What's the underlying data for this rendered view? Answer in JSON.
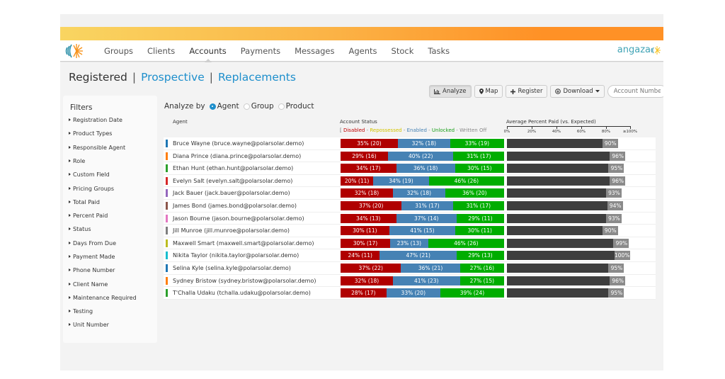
{
  "nav": {
    "items": [
      "Groups",
      "Clients",
      "Accounts",
      "Payments",
      "Messages",
      "Agents",
      "Stock",
      "Tasks"
    ],
    "active": "Accounts",
    "brand": "angaza"
  },
  "subnav": {
    "current": "Registered",
    "links": [
      "Prospective",
      "Replacements"
    ],
    "separator": "|"
  },
  "toolbar": {
    "analyze_label": "Analyze",
    "map_label": "Map",
    "register_label": "Register",
    "download_label": "Download",
    "account_placeholder": "Account Number"
  },
  "filters": {
    "title": "Filters",
    "items": [
      "Registration Date",
      "Product Types",
      "Responsible Agent",
      "Role",
      "Custom Field",
      "Pricing Groups",
      "Total Paid",
      "Percent Paid",
      "Status",
      "Days From Due",
      "Payment Made",
      "Phone Number",
      "Client Name",
      "Maintenance Required",
      "Testing",
      "Unit Number"
    ]
  },
  "analyze": {
    "label": "Analyze by",
    "options": [
      "Agent",
      "Group",
      "Product"
    ],
    "selected": "Agent"
  },
  "table": {
    "agent_header": "Agent",
    "status_header": "Account Status",
    "legend": {
      "open": "[",
      "disabled": "Disabled",
      "repossessed": "Repossessed",
      "enabled": "Enabled",
      "unlocked": "Unlocked",
      "written_off": "Written Off",
      "sep": " - "
    },
    "paid_header": "Average Percent Paid (vs. Expected)",
    "paid_ticks": [
      "0%",
      "20%",
      "40%",
      "60%",
      "80%",
      "≥100%"
    ],
    "colors": {
      "disabled": "#b00000",
      "repossessed": "#d4c400",
      "enabled": "#4682b4",
      "unlocked": "#00ad00",
      "written_off": "#888888"
    },
    "rows": [
      {
        "agent": "Bruce Wayne (bruce.wayne@polarsolar.demo)",
        "color": "#1f77b4",
        "disabled": {
          "pct": 35,
          "n": 20,
          "label": "35% (20)"
        },
        "enabled": {
          "pct": 32,
          "n": 18,
          "label": "32% (18)"
        },
        "unlocked": {
          "pct": 33,
          "n": 19,
          "label": "33% (19)"
        },
        "paid": 90,
        "paid_label": "90%"
      },
      {
        "agent": "Diana Prince (diana.prince@polarsolar.demo)",
        "color": "#ff7f0e",
        "disabled": {
          "pct": 29,
          "n": 16,
          "label": "29% (16)"
        },
        "enabled": {
          "pct": 40,
          "n": 22,
          "label": "40% (22)"
        },
        "unlocked": {
          "pct": 31,
          "n": 17,
          "label": "31% (17)"
        },
        "paid": 96,
        "paid_label": "96%"
      },
      {
        "agent": "Ethan Hunt (ethan.hunt@polarsolar.demo)",
        "color": "#2ca02c",
        "disabled": {
          "pct": 34,
          "n": 17,
          "label": "34% (17)"
        },
        "enabled": {
          "pct": 36,
          "n": 18,
          "label": "36% (18)"
        },
        "unlocked": {
          "pct": 30,
          "n": 15,
          "label": "30% (15)"
        },
        "paid": 95,
        "paid_label": "95%"
      },
      {
        "agent": "Evelyn Salt (evelyn.salt@polarsolar.demo)",
        "color": "#d62728",
        "disabled": {
          "pct": 20,
          "n": 11,
          "label": "20% (11)"
        },
        "enabled": {
          "pct": 34,
          "n": 19,
          "label": "34% (19)"
        },
        "unlocked": {
          "pct": 46,
          "n": 26,
          "label": "46% (26)"
        },
        "paid": 96,
        "paid_label": "96%"
      },
      {
        "agent": "Jack Bauer (jack.bauer@polarsolar.demo)",
        "color": "#9467bd",
        "disabled": {
          "pct": 32,
          "n": 18,
          "label": "32% (18)"
        },
        "enabled": {
          "pct": 32,
          "n": 18,
          "label": "32% (18)"
        },
        "unlocked": {
          "pct": 36,
          "n": 20,
          "label": "36% (20)"
        },
        "paid": 93,
        "paid_label": "93%"
      },
      {
        "agent": "James Bond (james.bond@polarsolar.demo)",
        "color": "#8c564b",
        "disabled": {
          "pct": 37,
          "n": 20,
          "label": "37% (20)"
        },
        "enabled": {
          "pct": 31,
          "n": 17,
          "label": "31% (17)"
        },
        "unlocked": {
          "pct": 31,
          "n": 17,
          "label": "31% (17)"
        },
        "paid": 94,
        "paid_label": "94%"
      },
      {
        "agent": "Jason Bourne (jason.bourne@polarsolar.demo)",
        "color": "#e377c2",
        "disabled": {
          "pct": 34,
          "n": 13,
          "label": "34% (13)"
        },
        "enabled": {
          "pct": 37,
          "n": 14,
          "label": "37% (14)"
        },
        "unlocked": {
          "pct": 29,
          "n": 11,
          "label": "29% (11)"
        },
        "paid": 93,
        "paid_label": "93%"
      },
      {
        "agent": "Jill Munroe (jill.munroe@polarsolar.demo)",
        "color": "#7f7f7f",
        "disabled": {
          "pct": 30,
          "n": 11,
          "label": "30% (11)"
        },
        "enabled": {
          "pct": 41,
          "n": 15,
          "label": "41% (15)"
        },
        "unlocked": {
          "pct": 30,
          "n": 11,
          "label": "30% (11)"
        },
        "paid": 90,
        "paid_label": "90%"
      },
      {
        "agent": "Maxwell Smart (maxwell.smart@polarsolar.demo)",
        "color": "#bcbd22",
        "disabled": {
          "pct": 30,
          "n": 17,
          "label": "30% (17)"
        },
        "enabled": {
          "pct": 23,
          "n": 13,
          "label": "23% (13)"
        },
        "unlocked": {
          "pct": 46,
          "n": 26,
          "label": "46% (26)"
        },
        "paid": 99,
        "paid_label": "99%"
      },
      {
        "agent": "Nikita Taylor (nikita.taylor@polarsolar.demo)",
        "color": "#17becf",
        "disabled": {
          "pct": 24,
          "n": 11,
          "label": "24% (11)"
        },
        "enabled": {
          "pct": 47,
          "n": 21,
          "label": "47% (21)"
        },
        "unlocked": {
          "pct": 29,
          "n": 13,
          "label": "29% (13)"
        },
        "paid": 100,
        "paid_label": "100%"
      },
      {
        "agent": "Selina Kyle (selina.kyle@polarsolar.demo)",
        "color": "#1f77b4",
        "disabled": {
          "pct": 37,
          "n": 22,
          "label": "37% (22)"
        },
        "enabled": {
          "pct": 36,
          "n": 21,
          "label": "36% (21)"
        },
        "unlocked": {
          "pct": 27,
          "n": 16,
          "label": "27% (16)"
        },
        "paid": 95,
        "paid_label": "95%"
      },
      {
        "agent": "Sydney Bristow (sydney.bristow@polarsolar.demo)",
        "color": "#ff7f0e",
        "disabled": {
          "pct": 32,
          "n": 18,
          "label": "32% (18)"
        },
        "enabled": {
          "pct": 41,
          "n": 23,
          "label": "41% (23)"
        },
        "unlocked": {
          "pct": 27,
          "n": 15,
          "label": "27% (15)"
        },
        "paid": 96,
        "paid_label": "96%"
      },
      {
        "agent": "T'Challa Udaku (tchalla.udaku@polarsolar.demo)",
        "color": "#2ca02c",
        "disabled": {
          "pct": 28,
          "n": 17,
          "label": "28% (17)"
        },
        "enabled": {
          "pct": 33,
          "n": 20,
          "label": "33% (20)"
        },
        "unlocked": {
          "pct": 39,
          "n": 24,
          "label": "39% (24)"
        },
        "paid": 95,
        "paid_label": "95%"
      }
    ]
  }
}
